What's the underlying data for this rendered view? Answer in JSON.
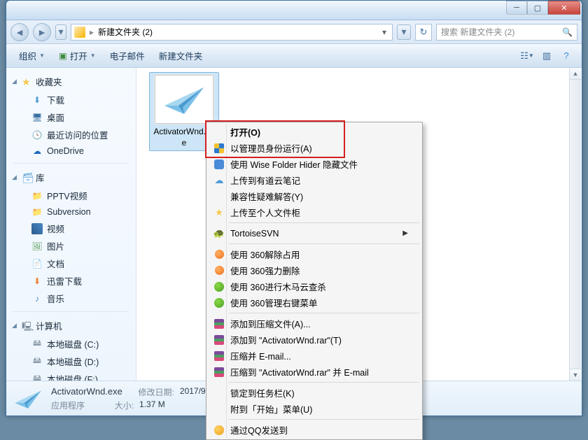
{
  "breadcrumb": {
    "path": "新建文件夹 (2)"
  },
  "search": {
    "placeholder": "搜索 新建文件夹 (2)"
  },
  "toolbar": {
    "organize": "组织",
    "open": "打开",
    "email": "电子邮件",
    "newfolder": "新建文件夹"
  },
  "sidebar": {
    "fav_header": "收藏夹",
    "fav": [
      {
        "label": "下载"
      },
      {
        "label": "桌面"
      },
      {
        "label": "最近访问的位置"
      },
      {
        "label": "OneDrive"
      }
    ],
    "lib_header": "库",
    "lib": [
      {
        "label": "PPTV视频"
      },
      {
        "label": "Subversion"
      },
      {
        "label": "视频"
      },
      {
        "label": "图片"
      },
      {
        "label": "文档"
      },
      {
        "label": "迅雷下载"
      },
      {
        "label": "音乐"
      }
    ],
    "comp_header": "计算机",
    "comp": [
      {
        "label": "本地磁盘 (C:)"
      },
      {
        "label": "本地磁盘 (D:)"
      },
      {
        "label": "本地磁盘 (F:)"
      }
    ]
  },
  "file": {
    "name": "ActivatorWnd.exe"
  },
  "status": {
    "filename": "ActivatorWnd.exe",
    "type": "应用程序",
    "date_label": "修改日期:",
    "date": "2017/9",
    "size_label": "大小:",
    "size": "1.37 M"
  },
  "ctx": {
    "items": [
      {
        "label": "打开(O)",
        "icon": ""
      },
      {
        "label": "以管理员身份运行(A)",
        "icon": "shield"
      },
      {
        "label": "使用 Wise Folder Hider 隐藏文件",
        "icon": "wise"
      },
      {
        "label": "上传到有道云笔记",
        "icon": "cloud"
      },
      {
        "label": "兼容性疑难解答(Y)",
        "icon": ""
      },
      {
        "label": "上传至个人文件柜",
        "icon": "star"
      }
    ],
    "tortoise": "TortoiseSVN",
    "sec360": [
      {
        "label": "使用 360解除占用",
        "icon": "orange"
      },
      {
        "label": "使用 360强力删除",
        "icon": "orange"
      },
      {
        "label": "使用 360进行木马云查杀",
        "icon": "360"
      },
      {
        "label": "使用 360管理右键菜单",
        "icon": "360"
      }
    ],
    "archive": [
      {
        "label": "添加到压缩文件(A)...",
        "icon": "rar"
      },
      {
        "label": "添加到 \"ActivatorWnd.rar\"(T)",
        "icon": "rar"
      },
      {
        "label": "压缩并 E-mail...",
        "icon": "rar"
      },
      {
        "label": "压缩到 \"ActivatorWnd.rar\" 并 E-mail",
        "icon": "rar"
      }
    ],
    "pin": [
      {
        "label": "锁定到任务栏(K)"
      },
      {
        "label": "附到「开始」菜单(U)"
      }
    ],
    "qq": "通过QQ发送到"
  }
}
